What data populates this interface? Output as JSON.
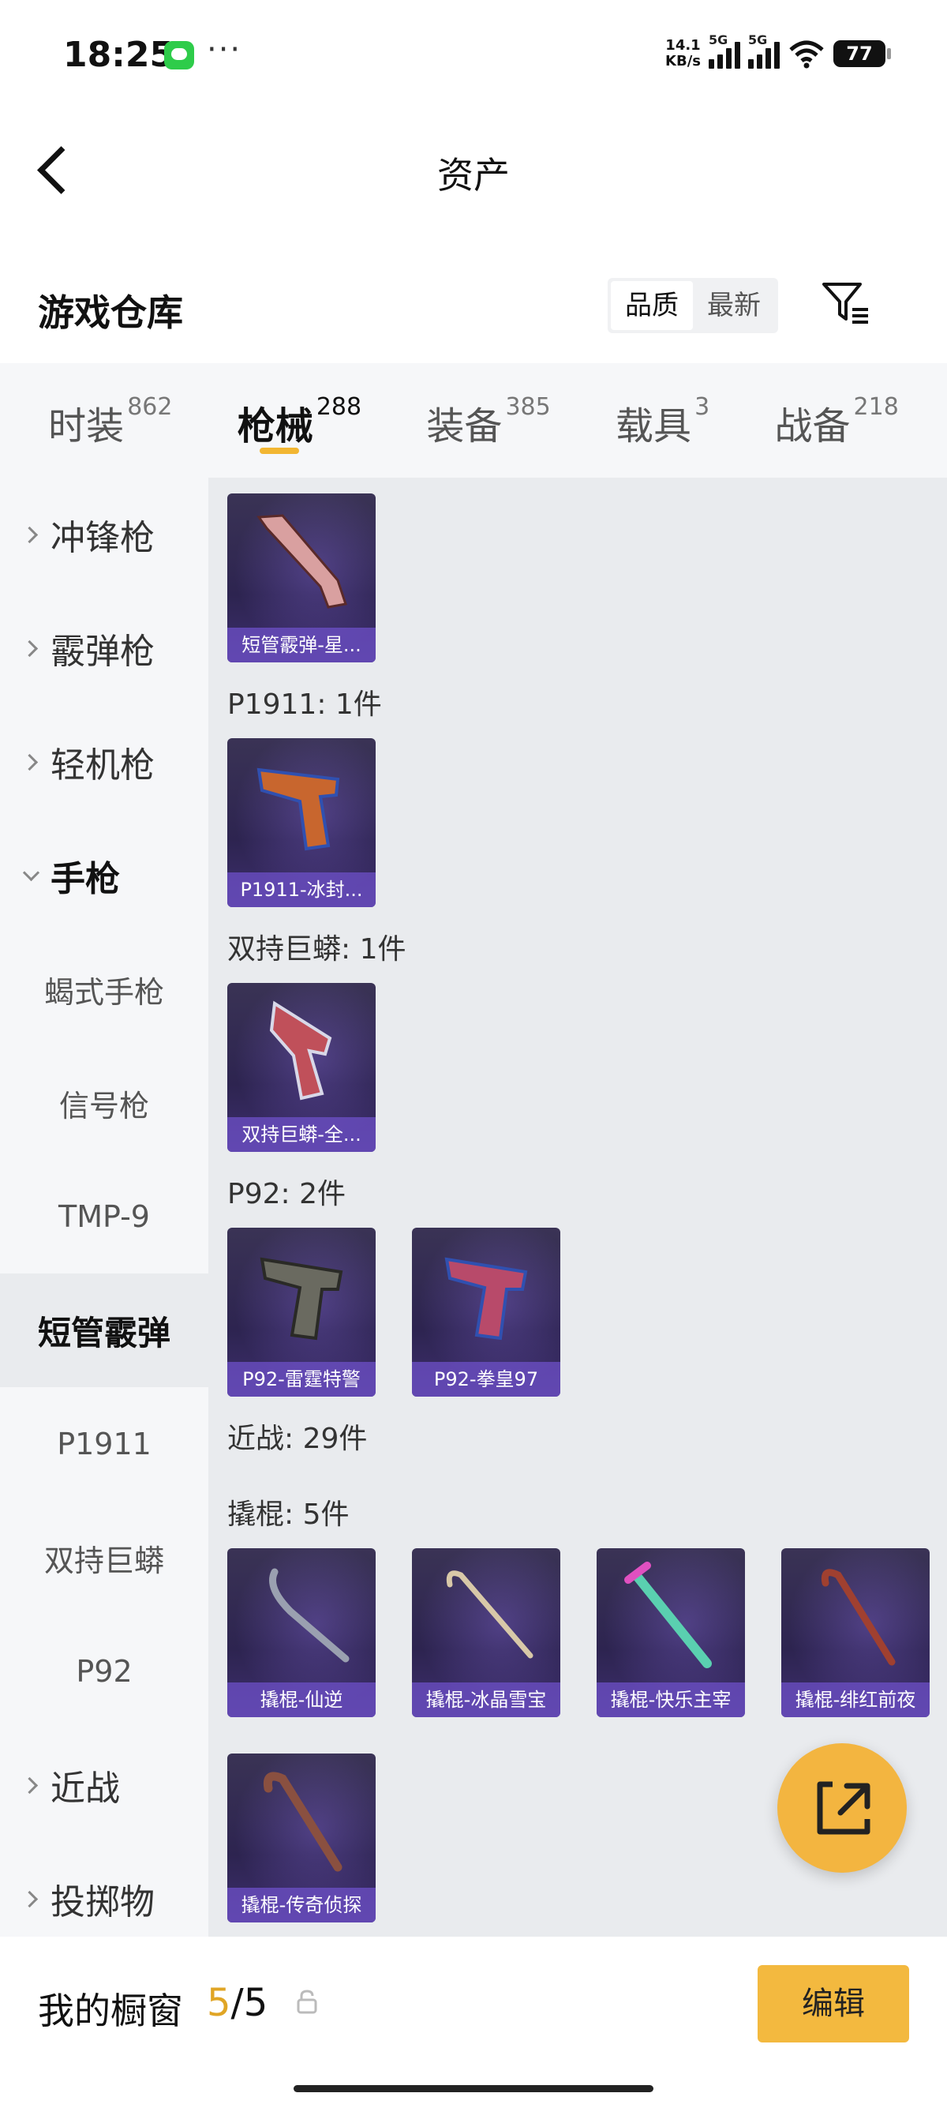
{
  "status": {
    "time": "18:25",
    "speed_top": "14.1",
    "speed_bottom": "KB/s",
    "sim1": "5G",
    "sim2": "5G",
    "battery": "77"
  },
  "header": {
    "title": "资产",
    "back_icon": "chevron-left-icon"
  },
  "warehouse": {
    "title": "游戏仓库",
    "sort_options": [
      "品质",
      "最新"
    ],
    "active_sort": "品质",
    "filter_icon": "filter-icon"
  },
  "tabs": [
    {
      "label": "时装",
      "count": "862"
    },
    {
      "label": "枪械",
      "count": "288",
      "active": true
    },
    {
      "label": "装备",
      "count": "385"
    },
    {
      "label": "载具",
      "count": "3"
    },
    {
      "label": "战备",
      "count": "218"
    }
  ],
  "sidebar": [
    {
      "label": "冲锋枪",
      "type": "group"
    },
    {
      "label": "霰弹枪",
      "type": "group"
    },
    {
      "label": "轻机枪",
      "type": "group"
    },
    {
      "label": "手枪",
      "type": "group",
      "open": true
    },
    {
      "label": "蝎式手枪",
      "type": "sub"
    },
    {
      "label": "信号枪",
      "type": "sub"
    },
    {
      "label": "TMP-9",
      "type": "sub"
    },
    {
      "label": "短管霰弹",
      "type": "sub",
      "selected": true
    },
    {
      "label": "P1911",
      "type": "sub"
    },
    {
      "label": "双持巨蟒",
      "type": "sub"
    },
    {
      "label": "P92",
      "type": "sub"
    },
    {
      "label": "近战",
      "type": "group"
    },
    {
      "label": "投掷物",
      "type": "group"
    }
  ],
  "content": {
    "groups": [
      {
        "label": "",
        "items": [
          {
            "name": "短管霰弹-星...",
            "color": "#d9a0a0"
          }
        ]
      },
      {
        "label": "P1911: 1件",
        "items": [
          {
            "name": "P1911-冰封...",
            "color": "#c8662e"
          }
        ]
      },
      {
        "label": "双持巨蟒: 1件",
        "items": [
          {
            "name": "双持巨蟒-全...",
            "color": "#c0505a"
          }
        ]
      },
      {
        "label": "P92: 2件",
        "items": [
          {
            "name": "P92-雷霆特警",
            "color": "#6a6a60"
          },
          {
            "name": "P92-拳皇97",
            "color": "#b84a6a"
          }
        ]
      },
      {
        "label": "近战: 29件",
        "items": []
      },
      {
        "label": "撬棍: 5件",
        "items": [
          {
            "name": "撬棍-仙逆",
            "color": "#9aa0b0"
          },
          {
            "name": "撬棍-冰晶雪宝",
            "color": "#d8c8a8"
          },
          {
            "name": "撬棍-快乐主宰",
            "color": "#5ad0b0"
          },
          {
            "name": "撬棍-绯红前夜",
            "color": "#a04030"
          },
          {
            "name": "撬棍-传奇侦探",
            "color": "#8a5040"
          }
        ]
      }
    ]
  },
  "fab": {
    "icon": "share-external-icon"
  },
  "bottom": {
    "label": "我的橱窗",
    "current": "5",
    "sep": "/",
    "total": "5",
    "lock_icon": "lock-icon",
    "edit_label": "编辑"
  }
}
